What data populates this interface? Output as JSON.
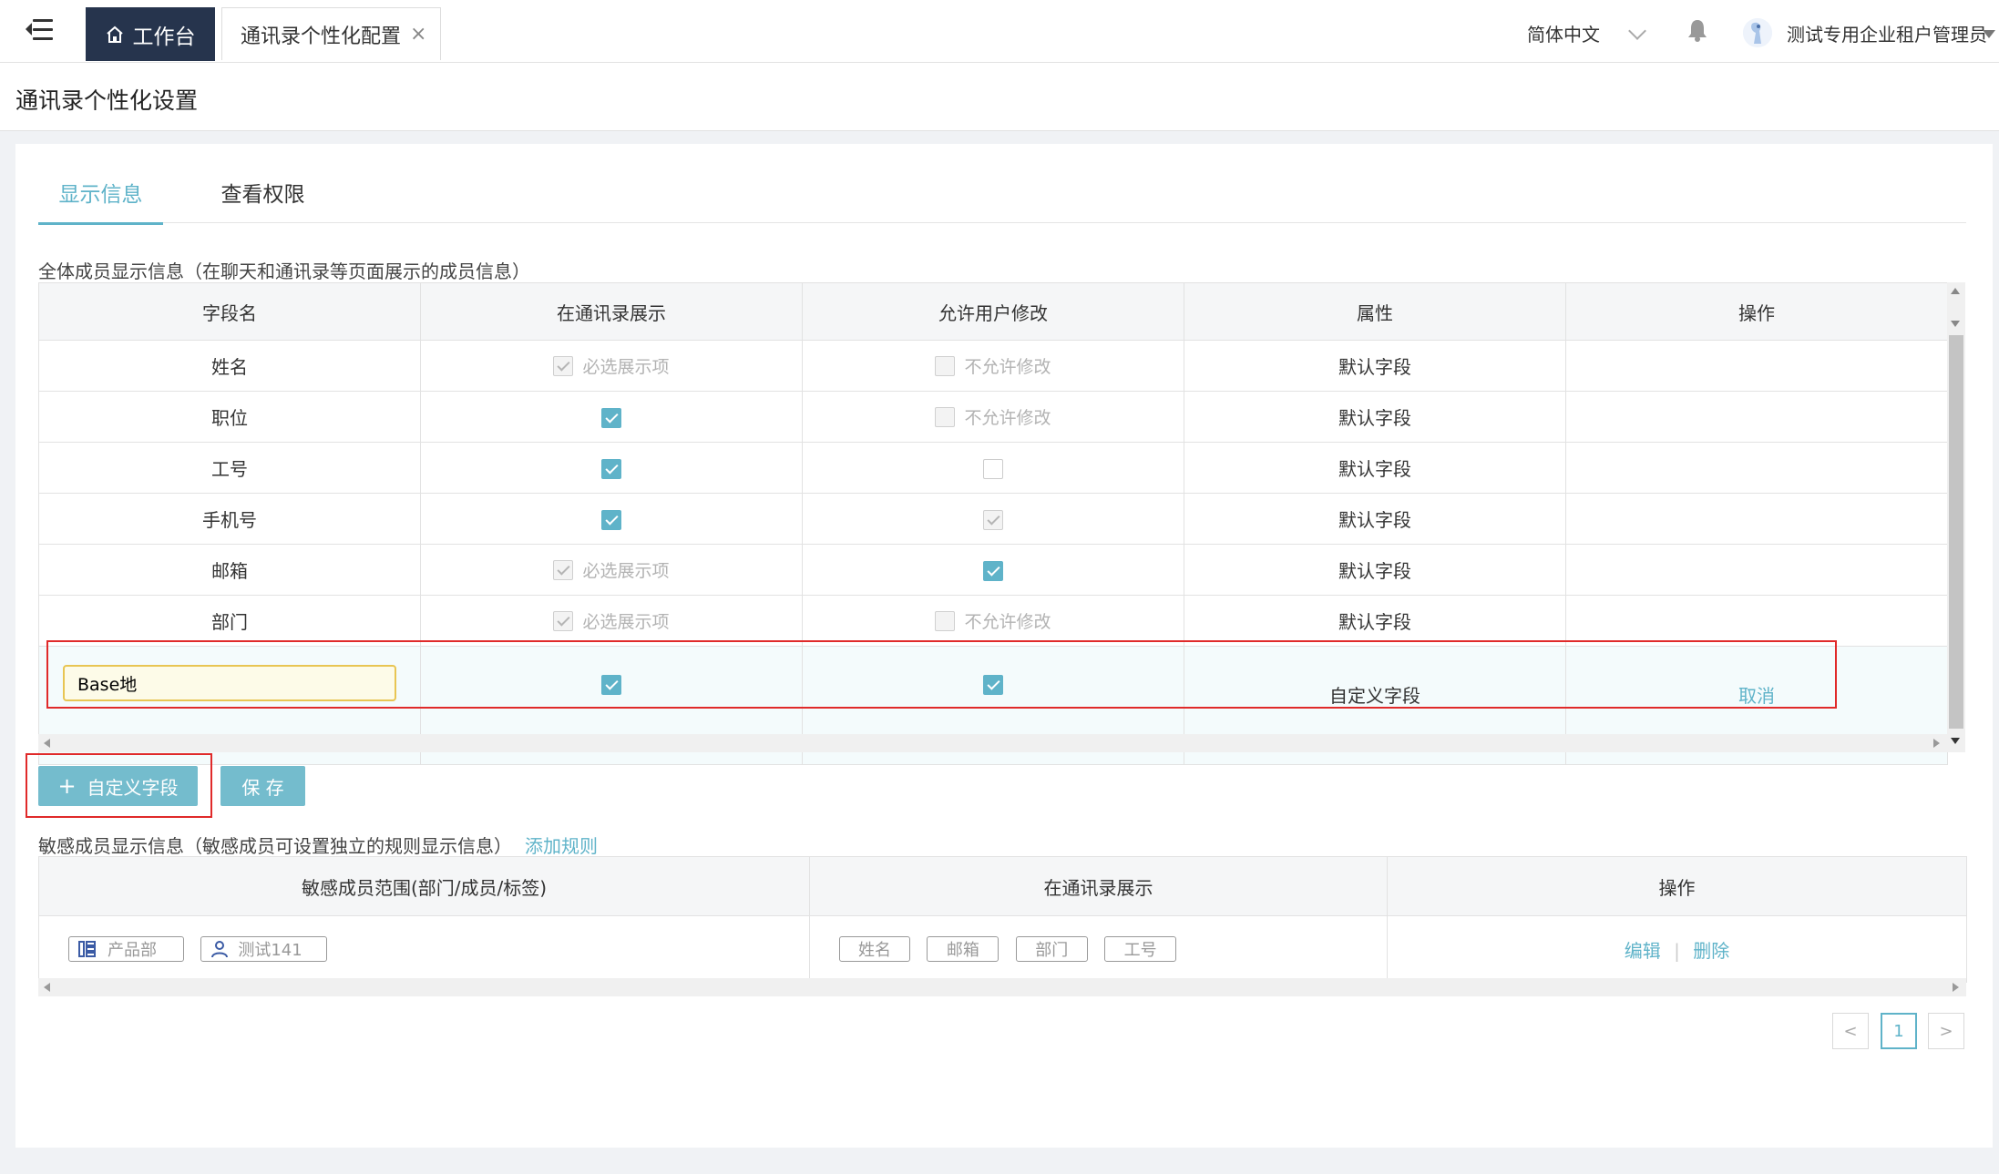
{
  "topbar": {
    "home_tab": "工作台",
    "open_tab": "通讯录个性化配置",
    "language": "简体中文",
    "username": "测试专用企业租户管理员"
  },
  "page": {
    "title": "通讯录个性化设置"
  },
  "tabs": [
    {
      "label": "显示信息",
      "active": true
    },
    {
      "label": "查看权限",
      "active": false
    }
  ],
  "all_members": {
    "label": "全体成员显示信息（在聊天和通讯录等页面展示的成员信息）",
    "columns": [
      "字段名",
      "在通讯录展示",
      "允许用户修改",
      "属性",
      "操作"
    ],
    "rows": [
      {
        "field": "姓名",
        "show": "required",
        "show_label": "必选展示项",
        "edit": "disabled",
        "edit_label": "不允许修改",
        "attr": "默认字段"
      },
      {
        "field": "职位",
        "show": "checked",
        "show_label": "",
        "edit": "disabled",
        "edit_label": "不允许修改",
        "attr": "默认字段"
      },
      {
        "field": "工号",
        "show": "checked",
        "show_label": "",
        "edit": "unchecked",
        "edit_label": "",
        "attr": "默认字段"
      },
      {
        "field": "手机号",
        "show": "checked",
        "show_label": "",
        "edit": "disabled-checked",
        "edit_label": "",
        "attr": "默认字段"
      },
      {
        "field": "邮箱",
        "show": "required",
        "show_label": "必选展示项",
        "edit": "checked",
        "edit_label": "",
        "attr": "默认字段"
      },
      {
        "field": "部门",
        "show": "required",
        "show_label": "必选展示项",
        "edit": "disabled",
        "edit_label": "不允许修改",
        "attr": "默认字段"
      }
    ],
    "custom_row": {
      "field_value": "Base地",
      "attr": "自定义字段",
      "action": "取消"
    }
  },
  "buttons": {
    "add_custom": "自定义字段",
    "save": "保 存"
  },
  "sensitive": {
    "label": "敏感成员显示信息（敏感成员可设置独立的规则显示信息）",
    "add_rule": "添加规则",
    "columns": [
      "敏感成员范围(部门/成员/标签)",
      "在通讯录展示",
      "操作"
    ],
    "scope_tags": [
      "产品部",
      "测试141"
    ],
    "show_tags": [
      "姓名",
      "邮箱",
      "部门",
      "工号"
    ],
    "actions": {
      "edit": "编辑",
      "separator": "|",
      "delete": "删除"
    }
  },
  "pagination": {
    "current": "1"
  },
  "colors": {
    "accent": "#5fb3c9",
    "nav_dark": "#26344d",
    "highlight": "#e02a2a"
  }
}
